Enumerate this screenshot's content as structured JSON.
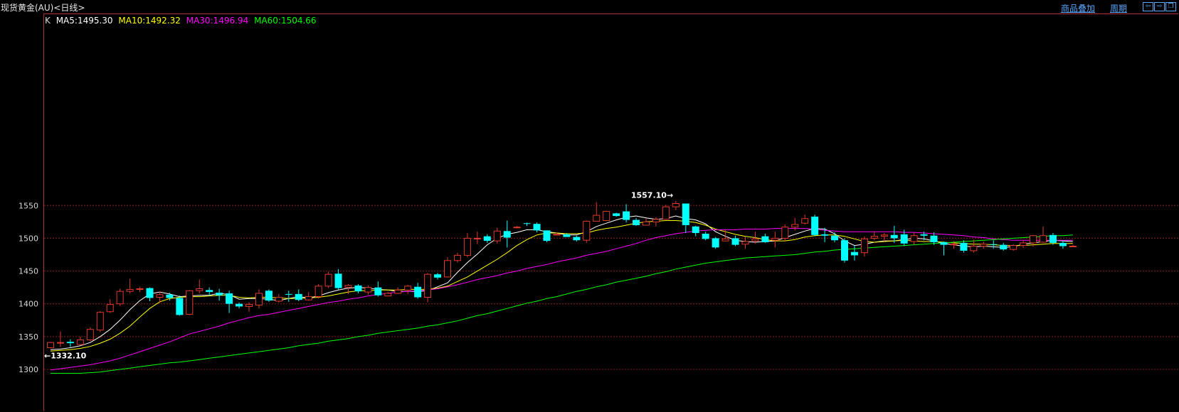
{
  "window": {
    "title": "现货黄金(AU)<日线>"
  },
  "toolbar": {
    "overlay_label": "商品叠加",
    "period_label": "周期"
  },
  "legend": {
    "prefix": "K",
    "ma5": "MA5:1495.30",
    "ma10": "MA10:1492.32",
    "ma30": "MA30:1496.94",
    "ma60": "MA60:1504.66"
  },
  "colors": {
    "background": "#000000",
    "up": "#e0392f",
    "down": "#00ffff",
    "ma5": "#ffffff",
    "ma10": "#ffff00",
    "ma30": "#ff00ff",
    "ma60": "#00ff00",
    "grid": "#8a1a1a",
    "axis_text": "#d8d8d8",
    "link": "#5aa8ff"
  },
  "chart_data": {
    "type": "candlestick",
    "y_ticks": [
      "1300",
      "1350",
      "1400",
      "1450",
      "1500",
      "1550"
    ],
    "ylim": [
      1290,
      1565
    ],
    "grid": true,
    "annotations": {
      "high": "1557.10",
      "low": "1332.10"
    },
    "candles": [
      [
        1333,
        1341,
        1332.1,
        1342
      ],
      [
        1340,
        1341,
        1334,
        1358
      ],
      [
        1342,
        1340,
        1334,
        1346
      ],
      [
        1338,
        1345,
        1337,
        1350
      ],
      [
        1345,
        1361,
        1343,
        1364
      ],
      [
        1360,
        1387,
        1357,
        1389
      ],
      [
        1388,
        1399,
        1386,
        1407
      ],
      [
        1400,
        1419,
        1397,
        1423
      ],
      [
        1419,
        1422,
        1416,
        1438
      ],
      [
        1422,
        1423,
        1418,
        1426
      ],
      [
        1424,
        1409,
        1404,
        1425
      ],
      [
        1410,
        1414,
        1401,
        1419
      ],
      [
        1414,
        1409,
        1405,
        1417
      ],
      [
        1409,
        1383,
        1382,
        1413
      ],
      [
        1384,
        1420,
        1383,
        1421
      ],
      [
        1420,
        1423,
        1416,
        1437
      ],
      [
        1421,
        1418,
        1412,
        1425
      ],
      [
        1417,
        1413,
        1405,
        1423
      ],
      [
        1416,
        1400,
        1386,
        1420
      ],
      [
        1400,
        1396,
        1393,
        1402
      ],
      [
        1396,
        1399,
        1388,
        1402
      ],
      [
        1398,
        1416,
        1393,
        1422
      ],
      [
        1420,
        1405,
        1403,
        1422
      ],
      [
        1404,
        1410,
        1402,
        1415
      ],
      [
        1415,
        1414,
        1403,
        1420
      ],
      [
        1415,
        1406,
        1404,
        1422
      ],
      [
        1406,
        1411,
        1405,
        1418
      ],
      [
        1411,
        1427,
        1408,
        1430
      ],
      [
        1427,
        1445,
        1424,
        1449
      ],
      [
        1446,
        1424,
        1422,
        1453
      ],
      [
        1425,
        1428,
        1415,
        1430
      ],
      [
        1428,
        1419,
        1416,
        1430
      ],
      [
        1418,
        1425,
        1414,
        1428
      ],
      [
        1425,
        1413,
        1411,
        1434
      ],
      [
        1412,
        1416,
        1412,
        1418
      ],
      [
        1416,
        1421,
        1415,
        1425
      ],
      [
        1421,
        1427,
        1415,
        1429
      ],
      [
        1426,
        1410,
        1408,
        1432
      ],
      [
        1410,
        1445,
        1402,
        1447
      ],
      [
        1445,
        1440,
        1437,
        1447
      ],
      [
        1441,
        1466,
        1440,
        1471
      ],
      [
        1466,
        1474,
        1463,
        1478
      ],
      [
        1474,
        1500,
        1471,
        1508
      ],
      [
        1500,
        1500,
        1491,
        1510
      ],
      [
        1503,
        1496,
        1493,
        1506
      ],
      [
        1496,
        1511,
        1492,
        1516
      ],
      [
        1511,
        1501,
        1486,
        1527
      ],
      [
        1517,
        1517,
        1515,
        1519
      ],
      [
        1523,
        1522,
        1519,
        1524
      ],
      [
        1522,
        1512,
        1509,
        1524
      ],
      [
        1512,
        1496,
        1494,
        1512
      ],
      [
        1506,
        1506,
        1505,
        1509
      ],
      [
        1506,
        1502,
        1502,
        1508
      ],
      [
        1502,
        1497,
        1495,
        1504
      ],
      [
        1497,
        1526,
        1493,
        1527
      ],
      [
        1526,
        1535,
        1532,
        1555
      ],
      [
        1527,
        1541,
        1526,
        1542
      ],
      [
        1538,
        1534,
        1533,
        1539
      ],
      [
        1541,
        1528,
        1524,
        1552
      ],
      [
        1528,
        1520,
        1519,
        1531
      ],
      [
        1520,
        1525,
        1520,
        1530
      ],
      [
        1525,
        1529,
        1518,
        1532
      ],
      [
        1529,
        1548,
        1530,
        1551
      ],
      [
        1548,
        1553,
        1543,
        1557.1
      ],
      [
        1553,
        1520,
        1508,
        1553
      ],
      [
        1518,
        1508,
        1503,
        1519
      ],
      [
        1507,
        1499,
        1497,
        1510
      ],
      [
        1500,
        1486,
        1484,
        1502
      ],
      [
        1496,
        1499,
        1495,
        1512
      ],
      [
        1500,
        1490,
        1488,
        1504
      ],
      [
        1491,
        1495,
        1484,
        1502
      ],
      [
        1496,
        1499,
        1492,
        1510
      ],
      [
        1503,
        1494,
        1493,
        1507
      ],
      [
        1497,
        1500,
        1486,
        1510
      ],
      [
        1500,
        1517,
        1495,
        1521
      ],
      [
        1517,
        1521,
        1512,
        1531
      ],
      [
        1523,
        1530,
        1521,
        1536
      ],
      [
        1533,
        1505,
        1503,
        1536
      ],
      [
        1506,
        1504,
        1494,
        1516
      ],
      [
        1504,
        1497,
        1494,
        1509
      ],
      [
        1497,
        1466,
        1463,
        1500
      ],
      [
        1479,
        1474,
        1466,
        1489
      ],
      [
        1478,
        1499,
        1472,
        1503
      ],
      [
        1500,
        1503,
        1497,
        1510
      ],
      [
        1503,
        1505,
        1495,
        1508
      ],
      [
        1505,
        1500,
        1493,
        1519
      ],
      [
        1506,
        1492,
        1488,
        1513
      ],
      [
        1495,
        1504,
        1490,
        1509
      ],
      [
        1506,
        1504,
        1497,
        1510
      ],
      [
        1504,
        1494,
        1490,
        1509
      ],
      [
        1494,
        1490,
        1474,
        1495
      ],
      [
        1490,
        1491,
        1484,
        1496
      ],
      [
        1493,
        1481,
        1478,
        1497
      ],
      [
        1481,
        1488,
        1478,
        1498
      ],
      [
        1488,
        1491,
        1484,
        1495
      ],
      [
        1491,
        1490,
        1484,
        1497
      ],
      [
        1490,
        1483,
        1481,
        1493
      ],
      [
        1483,
        1489,
        1481,
        1491
      ],
      [
        1489,
        1493,
        1485,
        1497
      ],
      [
        1493,
        1504,
        1487,
        1505
      ],
      [
        1494,
        1504,
        1493,
        1518
      ],
      [
        1505,
        1493,
        1490,
        1508
      ],
      [
        1493,
        1488,
        1484,
        1496
      ],
      [
        1488,
        1488,
        1487,
        1490
      ]
    ],
    "ma_series": [
      {
        "name": "MA5",
        "values": [
          1330,
          1331,
          1333,
          1336,
          1341,
          1350,
          1361,
          1375,
          1391,
          1405,
          1415,
          1418,
          1415,
          1411,
          1412,
          1413,
          1413,
          1416,
          1414,
          1407,
          1408,
          1408,
          1407,
          1405,
          1408,
          1411,
          1409,
          1412,
          1417,
          1421,
          1424,
          1425,
          1424,
          1422,
          1421,
          1419,
          1419,
          1419,
          1420,
          1426,
          1432,
          1448,
          1463,
          1476,
          1490,
          1500,
          1506,
          1509,
          1513,
          1513,
          1510,
          1508,
          1505,
          1505,
          1510,
          1518,
          1523,
          1528,
          1532,
          1534,
          1531,
          1529,
          1530,
          1534,
          1530,
          1528,
          1522,
          1510,
          1503,
          1497,
          1495,
          1494,
          1495,
          1496,
          1501,
          1506,
          1511,
          1515,
          1514,
          1507,
          1496,
          1489,
          1491,
          1494,
          1496,
          1496,
          1498,
          1500,
          1499,
          1496,
          1492,
          1490,
          1488,
          1487,
          1488,
          1487,
          1486,
          1487,
          1491,
          1493,
          1495,
          1497,
          1496,
          1495
        ]
      },
      {
        "name": "MA10",
        "values": [
          1328,
          1329,
          1330,
          1332,
          1335,
          1340,
          1346,
          1355,
          1366,
          1380,
          1393,
          1403,
          1408,
          1410,
          1411,
          1411,
          1412,
          1413,
          1413,
          1410,
          1409,
          1410,
          1410,
          1409,
          1408,
          1408,
          1409,
          1410,
          1412,
          1415,
          1418,
          1420,
          1420,
          1421,
          1421,
          1421,
          1422,
          1422,
          1422,
          1424,
          1427,
          1434,
          1441,
          1450,
          1459,
          1468,
          1478,
          1489,
          1498,
          1505,
          1508,
          1508,
          1507,
          1507,
          1508,
          1512,
          1515,
          1517,
          1520,
          1523,
          1525,
          1526,
          1527,
          1527,
          1526,
          1524,
          1520,
          1514,
          1510,
          1506,
          1503,
          1501,
          1498,
          1496,
          1496,
          1498,
          1502,
          1504,
          1505,
          1505,
          1503,
          1499,
          1495,
          1494,
          1495,
          1496,
          1497,
          1496,
          1495,
          1495,
          1494,
          1493,
          1492,
          1491,
          1491,
          1490,
          1489,
          1489,
          1489,
          1490,
          1491,
          1492,
          1492,
          1492
        ]
      },
      {
        "name": "MA30",
        "values": [
          1299,
          1301,
          1303,
          1305,
          1307,
          1310,
          1313,
          1317,
          1322,
          1327,
          1332,
          1337,
          1342,
          1348,
          1354,
          1358,
          1362,
          1366,
          1371,
          1375,
          1379,
          1382,
          1384,
          1387,
          1390,
          1393,
          1396,
          1399,
          1402,
          1404,
          1407,
          1409,
          1412,
          1414,
          1416,
          1418,
          1419,
          1420,
          1421,
          1423,
          1426,
          1429,
          1433,
          1437,
          1440,
          1443,
          1447,
          1450,
          1454,
          1457,
          1460,
          1464,
          1467,
          1470,
          1474,
          1477,
          1480,
          1484,
          1488,
          1492,
          1497,
          1501,
          1504,
          1507,
          1509,
          1511,
          1512,
          1513,
          1513,
          1513,
          1514,
          1514,
          1514,
          1515,
          1515,
          1515,
          1515,
          1514,
          1512,
          1511,
          1510,
          1510,
          1510,
          1510,
          1510,
          1510,
          1509,
          1509,
          1508,
          1507,
          1506,
          1505,
          1504,
          1502,
          1501,
          1499,
          1498,
          1497,
          1497,
          1497,
          1497,
          1497,
          1497,
          1497
        ]
      },
      {
        "name": "MA60",
        "values": [
          1294,
          1294,
          1294,
          1294,
          1295,
          1296,
          1298,
          1300,
          1302,
          1304,
          1306,
          1308,
          1310,
          1311,
          1313,
          1315,
          1317,
          1319,
          1321,
          1323,
          1325,
          1327,
          1329,
          1331,
          1333,
          1336,
          1338,
          1340,
          1343,
          1345,
          1347,
          1350,
          1352,
          1355,
          1357,
          1359,
          1361,
          1363,
          1366,
          1368,
          1371,
          1374,
          1378,
          1382,
          1385,
          1389,
          1393,
          1397,
          1401,
          1404,
          1408,
          1411,
          1415,
          1419,
          1422,
          1426,
          1429,
          1433,
          1436,
          1439,
          1442,
          1446,
          1449,
          1453,
          1456,
          1459,
          1462,
          1464,
          1466,
          1468,
          1470,
          1471,
          1472,
          1473,
          1474,
          1475,
          1477,
          1479,
          1480,
          1482,
          1483,
          1484,
          1485,
          1486,
          1487,
          1488,
          1489,
          1490,
          1491,
          1492,
          1493,
          1494,
          1495,
          1496,
          1497,
          1498,
          1499,
          1500,
          1501,
          1502,
          1503,
          1504,
          1504,
          1505
        ]
      }
    ]
  }
}
